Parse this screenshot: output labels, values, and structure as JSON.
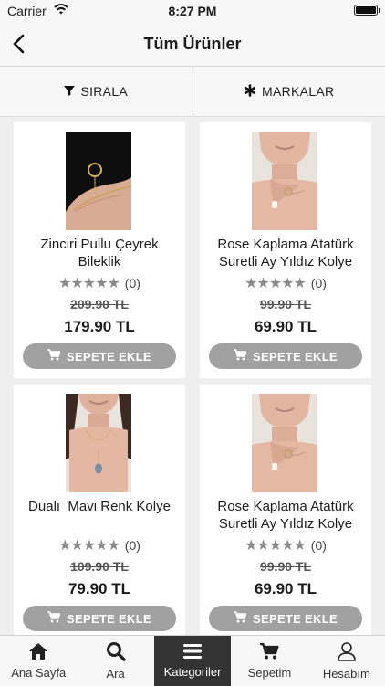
{
  "status": {
    "carrier": "Carrier",
    "time": "8:27 PM"
  },
  "nav": {
    "title": "Tüm Ürünler"
  },
  "filters": {
    "sort_label": "SIRALA",
    "brands_label": "MARKALAR"
  },
  "products": [
    {
      "name": "Zinciri Pullu Çeyrek Bileklik",
      "rating_count": "(0)",
      "rating_stars": 5,
      "old_price": "209.90 TL",
      "price": "179.90 TL",
      "cart_label": "SEPETE EKLE"
    },
    {
      "name": "Rose Kaplama Atatürk Suretli Ay Yıldız Kolye",
      "rating_count": "(0)",
      "rating_stars": 5,
      "old_price": "99.90 TL",
      "price": "69.90 TL",
      "cart_label": "SEPETE EKLE"
    },
    {
      "name": "Dualı  Mavi Renk Kolye",
      "rating_count": "(0)",
      "rating_stars": 5,
      "old_price": "109.90 TL",
      "price": "79.90 TL",
      "cart_label": "SEPETE EKLE"
    },
    {
      "name": "Rose Kaplama Atatürk Suretli Ay Yıldız Kolye",
      "rating_count": "(0)",
      "rating_stars": 5,
      "old_price": "99.90 TL",
      "price": "69.90 TL",
      "cart_label": "SEPETE EKLE"
    }
  ],
  "tabs": [
    {
      "label": "Ana Sayfa",
      "icon": "home-icon"
    },
    {
      "label": "Ara",
      "icon": "search-icon"
    },
    {
      "label": "Kategoriler",
      "icon": "menu-icon",
      "active": true
    },
    {
      "label": "Sepetim",
      "icon": "cart-icon"
    },
    {
      "label": "Hesabım",
      "icon": "user-icon"
    }
  ],
  "colors": {
    "accent_dark": "#333333",
    "button_gray": "#a1a1a1",
    "background": "#efefef",
    "star_gray": "#8a8a8a"
  }
}
